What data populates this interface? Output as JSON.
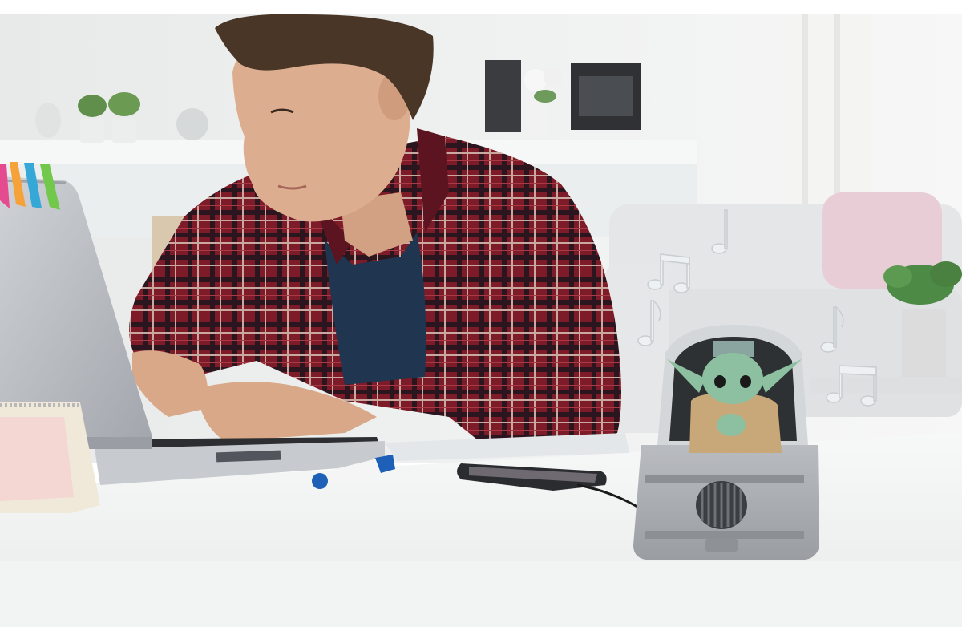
{
  "colors": {
    "background": "#ffffff",
    "room_wall": "#eef0f0",
    "desk": "#f4f5f5",
    "shirt_red": "#8a1f2b",
    "shirt_dark": "#2a1a22",
    "tshirt_blue": "#1f3550",
    "skin": "#d9a98a",
    "hair": "#4a3626",
    "laptop_silver": "#b8bcc2",
    "speaker_gray": "#a8acb0",
    "grogu_green": "#8cc0a0",
    "robe_tan": "#c8a878",
    "marker_blue": "#1e5fb8"
  },
  "icons": [
    "music-note-icon",
    "music-note-icon",
    "music-note-icon",
    "music-note-icon",
    "music-note-icon"
  ]
}
